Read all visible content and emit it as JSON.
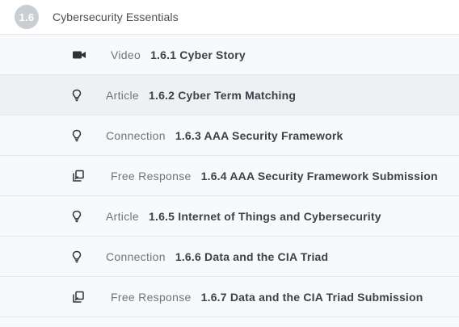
{
  "section": {
    "number": "1.6",
    "title": "Cybersecurity Essentials"
  },
  "lessons": [
    {
      "type": "Video",
      "title": "1.6.1 Cyber Story",
      "icon": "video-camera-icon"
    },
    {
      "type": "Article",
      "title": "1.6.2 Cyber Term Matching",
      "icon": "lightbulb-icon"
    },
    {
      "type": "Connection",
      "title": "1.6.3 AAA Security Framework",
      "icon": "lightbulb-icon"
    },
    {
      "type": "Free Response",
      "title": "1.6.4 AAA Security Framework Submission",
      "icon": "free-response-icon"
    },
    {
      "type": "Article",
      "title": "1.6.5 Internet of Things and Cybersecurity",
      "icon": "lightbulb-icon"
    },
    {
      "type": "Connection",
      "title": "1.6.6 Data and the CIA Triad",
      "icon": "lightbulb-icon"
    },
    {
      "type": "Free Response",
      "title": "1.6.7 Data and the CIA Triad Submission",
      "icon": "free-response-icon"
    }
  ],
  "colors": {
    "badge": "#c9ced3",
    "row_background": "#f7f9fb",
    "row_hover": "#eef1f4",
    "divider": "#e2e6ea",
    "icon": "#2f3338"
  }
}
